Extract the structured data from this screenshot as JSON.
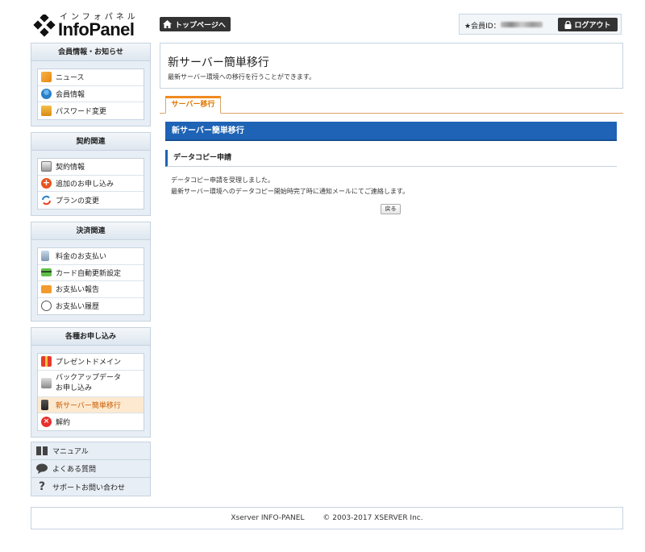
{
  "header": {
    "logo_kana": "インフォパネル",
    "logo_name": "InfoPanel",
    "top_button": "トップページへ",
    "member_label": "★会員ID：",
    "logout_button": "ログアウト"
  },
  "sidebar": {
    "sections": [
      {
        "title": "会員情報・お知らせ",
        "items": [
          {
            "label": "ニュース",
            "icon": "news-icon"
          },
          {
            "label": "会員情報",
            "icon": "user-icon"
          },
          {
            "label": "パスワード変更",
            "icon": "key-icon"
          }
        ]
      },
      {
        "title": "契約関連",
        "items": [
          {
            "label": "契約情報",
            "icon": "contract-icon"
          },
          {
            "label": "追加のお申し込み",
            "icon": "add-icon"
          },
          {
            "label": "プランの変更",
            "icon": "change-icon"
          }
        ]
      },
      {
        "title": "決済関連",
        "items": [
          {
            "label": "料金のお支払い",
            "icon": "calculator-icon"
          },
          {
            "label": "カード自動更新設定",
            "icon": "card-icon"
          },
          {
            "label": "お支払い報告",
            "icon": "report-icon"
          },
          {
            "label": "お支払い履歴",
            "icon": "clock-icon"
          }
        ]
      },
      {
        "title": "各種お申し込み",
        "items": [
          {
            "label": "プレゼントドメイン",
            "icon": "gift-icon"
          },
          {
            "label": "バックアップデータ",
            "label2": "お申し込み",
            "icon": "backup-icon"
          },
          {
            "label": "新サーバー簡単移行",
            "icon": "server-icon",
            "active": true
          },
          {
            "label": "解約",
            "icon": "cancel-icon"
          }
        ]
      }
    ],
    "links": [
      {
        "label": "マニュアル",
        "icon": "book-icon"
      },
      {
        "label": "よくある質問",
        "icon": "speech-bubble-icon"
      },
      {
        "label": "サポートお問い合わせ",
        "icon": "question-icon"
      }
    ]
  },
  "main": {
    "title": "新サーバー簡単移行",
    "description": "最新サーバー環境への移行を行うことができます。",
    "tab": "サーバー移行",
    "section_title": "新サーバー簡単移行",
    "subsection_title": "データコピー申請",
    "message_line1": "データコピー申請を受理しました。",
    "message_line2": "最新サーバー環境へのデータコピー開始時完了時に通知メールにてご連絡します。",
    "back_button": "戻る"
  },
  "footer": {
    "product": "Xserver INFO-PANEL",
    "copyright": "© 2003-2017 XSERVER Inc."
  },
  "colors": {
    "accent_blue": "#1e63b5",
    "tab_orange": "#f08a1e",
    "active_bg": "#fde9cf"
  }
}
